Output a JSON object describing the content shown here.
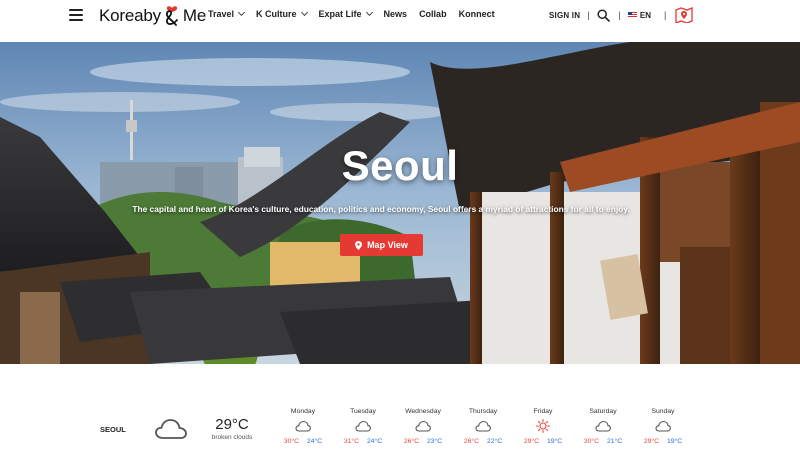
{
  "header": {
    "logo_left": "Koreaby",
    "logo_right": "Me",
    "nav": [
      {
        "label": "Travel",
        "dropdown": true
      },
      {
        "label": "K Culture",
        "dropdown": true
      },
      {
        "label": "Expat Life",
        "dropdown": true
      },
      {
        "label": "News",
        "dropdown": false
      },
      {
        "label": "Collab",
        "dropdown": false
      },
      {
        "label": "Konnect",
        "dropdown": false
      }
    ],
    "sign_in": "SIGN IN",
    "separator": "|",
    "language": "EN"
  },
  "hero": {
    "title": "Seoul",
    "subtitle": "The capital and heart of Korea's culture, education, politics and economy, Seoul offers a myriad of attractions for all to enjoy.",
    "map_button": "Map View"
  },
  "weather": {
    "city": "SEOUL",
    "current_temp": "29°C",
    "condition": "broken clouds",
    "days": [
      {
        "name": "Monday",
        "icon": "cloud-icon",
        "high": "30°C",
        "low": "24°C"
      },
      {
        "name": "Tuesday",
        "icon": "cloud-icon",
        "high": "31°C",
        "low": "24°C"
      },
      {
        "name": "Wednesday",
        "icon": "cloud-icon",
        "high": "26°C",
        "low": "23°C"
      },
      {
        "name": "Thursday",
        "icon": "cloud-icon",
        "high": "26°C",
        "low": "22°C"
      },
      {
        "name": "Friday",
        "icon": "sun-icon",
        "high": "29°C",
        "low": "19°C"
      },
      {
        "name": "Saturday",
        "icon": "cloud-icon",
        "high": "30°C",
        "low": "21°C"
      },
      {
        "name": "Sunday",
        "icon": "cloud-icon",
        "high": "29°C",
        "low": "19°C"
      }
    ]
  },
  "colors": {
    "accent": "#e53a33",
    "high_temp": "#e5473d",
    "low_temp": "#2c6fd6"
  }
}
